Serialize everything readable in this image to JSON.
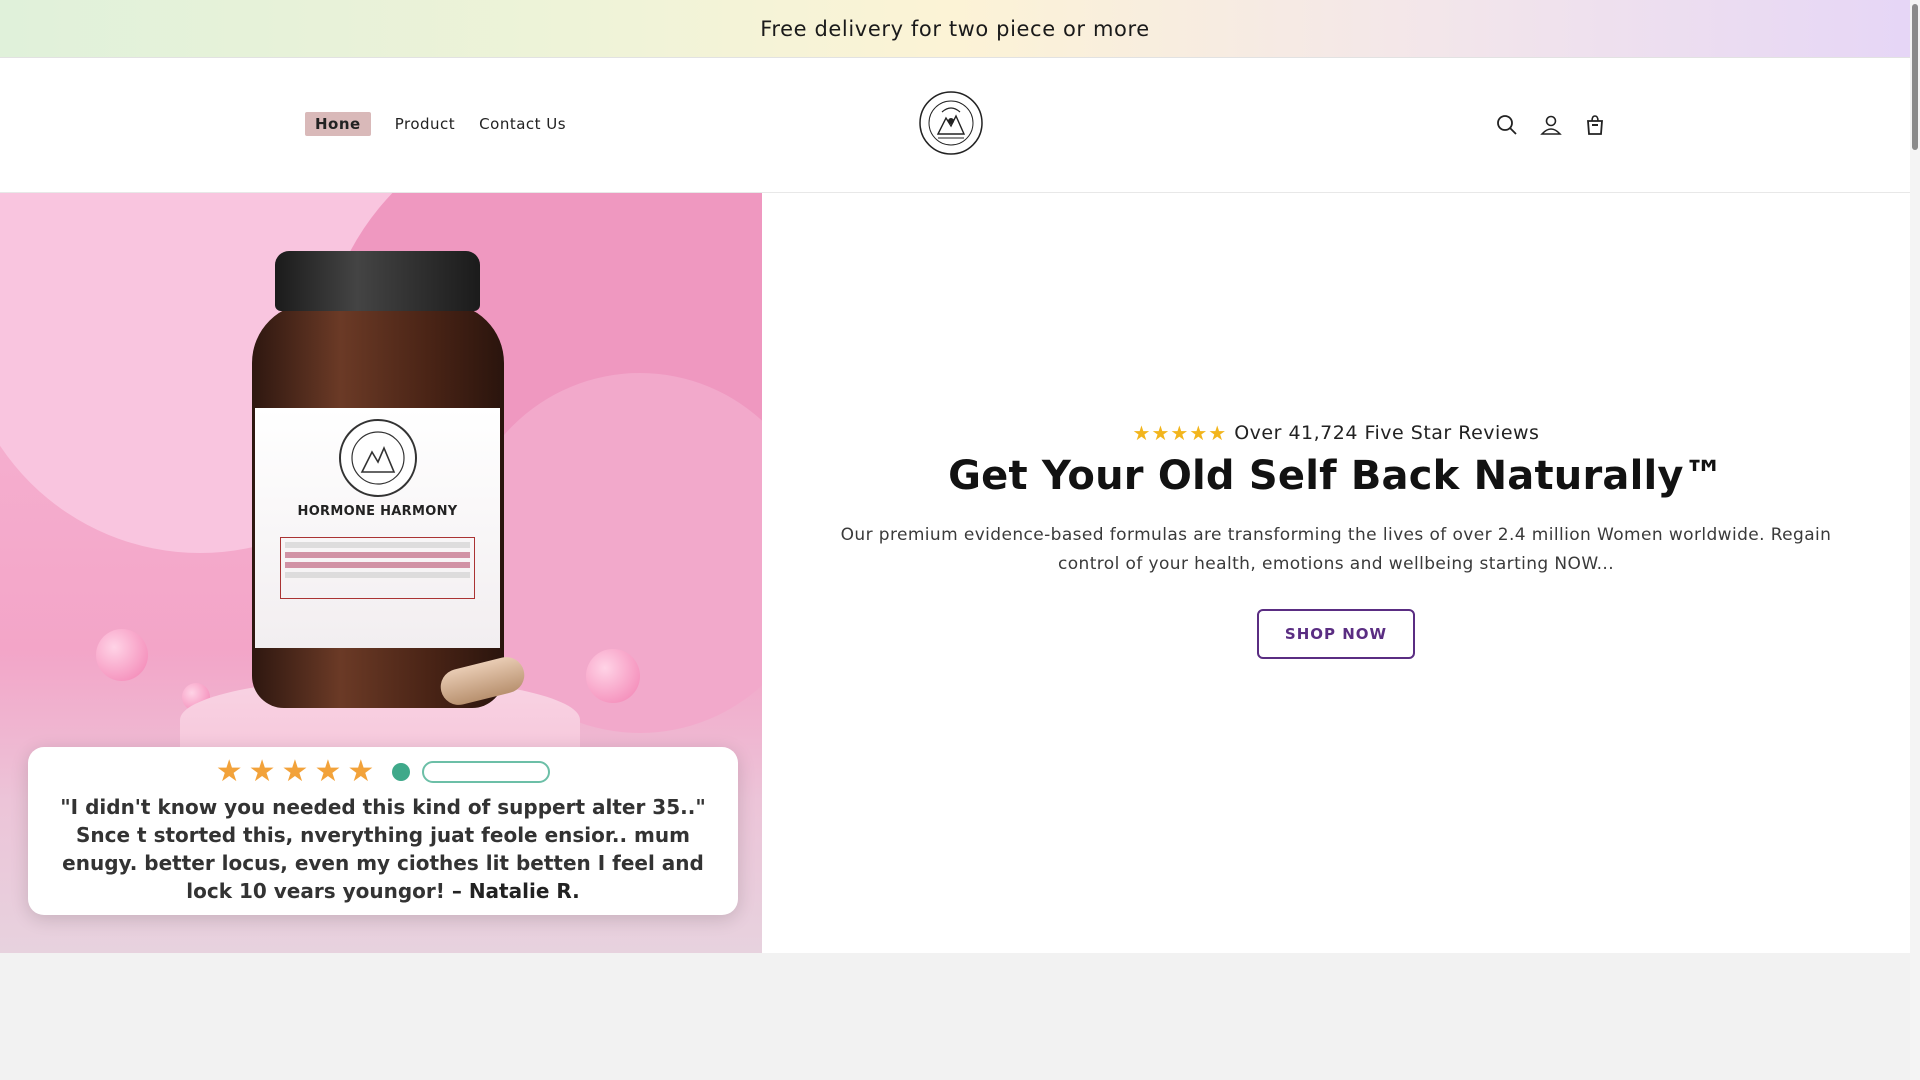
{
  "announcement": {
    "text": "Free delivery for two piece or more"
  },
  "nav": {
    "home": "Hone",
    "product": "Product",
    "contact": "Contact Us"
  },
  "hero": {
    "product_brand": "HORMONE HARMONY",
    "review_card": {
      "stars": 5,
      "quote": "\"I didn't know you needed this kind of suppert alter 35..\" Snce t storted this, nverything juat feole ensior.. mum enugy. better locus, even my ciothes lit betten I feel and lock 10 vears youngor!",
      "author": "– Natalie R."
    },
    "rating_stars": 5,
    "rating_text": "Over 41,724 Five Star Reviews",
    "headline": "Get Your Old Self Back Naturally™",
    "subtext": "Our premium evidence-based formulas are transforming the lives of over 2.4 million Women worldwide. Regain control of your health, emotions and wellbeing starting NOW...",
    "cta": "SHOP NOW"
  },
  "colors": {
    "accent": "#5a2d82",
    "star": "#f2b51d",
    "nav_active_bg": "#d9b9b9",
    "hero_bg": "#f3a5c8"
  },
  "icons": [
    "search-icon",
    "account-icon",
    "cart-icon",
    "star-icon",
    "verified-icon"
  ]
}
